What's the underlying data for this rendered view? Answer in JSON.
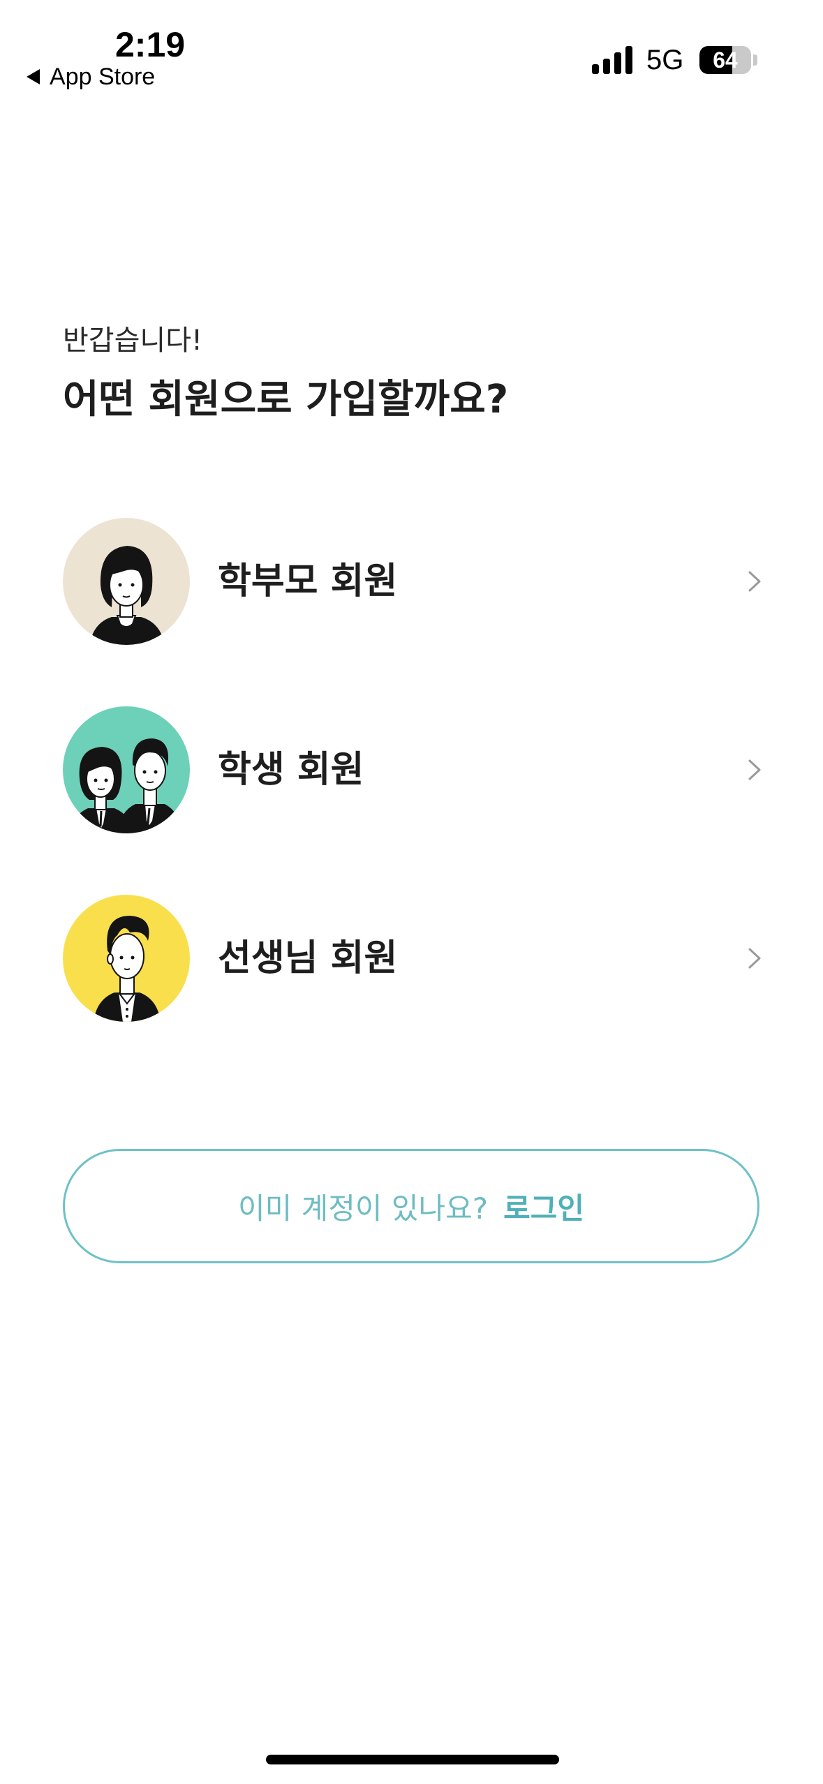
{
  "status_bar": {
    "time": "2:19",
    "back_label": "App Store",
    "network": "5G",
    "battery_percent": "64",
    "battery_level": 0.64
  },
  "heading": {
    "greeting": "반갑습니다!",
    "question": "어떤 회원으로 가입할까요?"
  },
  "member_types": [
    {
      "label": "학부모 회원",
      "avatar_color": "#ece3d2",
      "icon": "parent-avatar-icon"
    },
    {
      "label": "학생 회원",
      "avatar_color": "#6dd0b8",
      "icon": "students-avatar-icon"
    },
    {
      "label": "선생님 회원",
      "avatar_color": "#fadf4c",
      "icon": "teacher-avatar-icon"
    }
  ],
  "login": {
    "prompt": "이미 계정이 있나요?",
    "link": "로그인",
    "accent_color": "#6ec1c6"
  }
}
